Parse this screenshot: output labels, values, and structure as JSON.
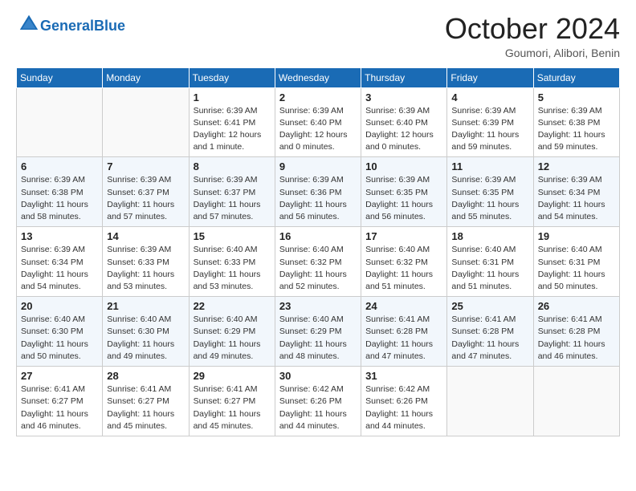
{
  "header": {
    "logo_general": "General",
    "logo_blue": "Blue",
    "month": "October 2024",
    "location": "Goumori, Alibori, Benin"
  },
  "days_of_week": [
    "Sunday",
    "Monday",
    "Tuesday",
    "Wednesday",
    "Thursday",
    "Friday",
    "Saturday"
  ],
  "weeks": [
    [
      {
        "day": "",
        "sunrise": "",
        "sunset": "",
        "daylight": "",
        "empty": true
      },
      {
        "day": "",
        "sunrise": "",
        "sunset": "",
        "daylight": "",
        "empty": true
      },
      {
        "day": "1",
        "sunrise": "Sunrise: 6:39 AM",
        "sunset": "Sunset: 6:41 PM",
        "daylight": "Daylight: 12 hours and 1 minute."
      },
      {
        "day": "2",
        "sunrise": "Sunrise: 6:39 AM",
        "sunset": "Sunset: 6:40 PM",
        "daylight": "Daylight: 12 hours and 0 minutes."
      },
      {
        "day": "3",
        "sunrise": "Sunrise: 6:39 AM",
        "sunset": "Sunset: 6:40 PM",
        "daylight": "Daylight: 12 hours and 0 minutes."
      },
      {
        "day": "4",
        "sunrise": "Sunrise: 6:39 AM",
        "sunset": "Sunset: 6:39 PM",
        "daylight": "Daylight: 11 hours and 59 minutes."
      },
      {
        "day": "5",
        "sunrise": "Sunrise: 6:39 AM",
        "sunset": "Sunset: 6:38 PM",
        "daylight": "Daylight: 11 hours and 59 minutes."
      }
    ],
    [
      {
        "day": "6",
        "sunrise": "Sunrise: 6:39 AM",
        "sunset": "Sunset: 6:38 PM",
        "daylight": "Daylight: 11 hours and 58 minutes."
      },
      {
        "day": "7",
        "sunrise": "Sunrise: 6:39 AM",
        "sunset": "Sunset: 6:37 PM",
        "daylight": "Daylight: 11 hours and 57 minutes."
      },
      {
        "day": "8",
        "sunrise": "Sunrise: 6:39 AM",
        "sunset": "Sunset: 6:37 PM",
        "daylight": "Daylight: 11 hours and 57 minutes."
      },
      {
        "day": "9",
        "sunrise": "Sunrise: 6:39 AM",
        "sunset": "Sunset: 6:36 PM",
        "daylight": "Daylight: 11 hours and 56 minutes."
      },
      {
        "day": "10",
        "sunrise": "Sunrise: 6:39 AM",
        "sunset": "Sunset: 6:35 PM",
        "daylight": "Daylight: 11 hours and 56 minutes."
      },
      {
        "day": "11",
        "sunrise": "Sunrise: 6:39 AM",
        "sunset": "Sunset: 6:35 PM",
        "daylight": "Daylight: 11 hours and 55 minutes."
      },
      {
        "day": "12",
        "sunrise": "Sunrise: 6:39 AM",
        "sunset": "Sunset: 6:34 PM",
        "daylight": "Daylight: 11 hours and 54 minutes."
      }
    ],
    [
      {
        "day": "13",
        "sunrise": "Sunrise: 6:39 AM",
        "sunset": "Sunset: 6:34 PM",
        "daylight": "Daylight: 11 hours and 54 minutes."
      },
      {
        "day": "14",
        "sunrise": "Sunrise: 6:39 AM",
        "sunset": "Sunset: 6:33 PM",
        "daylight": "Daylight: 11 hours and 53 minutes."
      },
      {
        "day": "15",
        "sunrise": "Sunrise: 6:40 AM",
        "sunset": "Sunset: 6:33 PM",
        "daylight": "Daylight: 11 hours and 53 minutes."
      },
      {
        "day": "16",
        "sunrise": "Sunrise: 6:40 AM",
        "sunset": "Sunset: 6:32 PM",
        "daylight": "Daylight: 11 hours and 52 minutes."
      },
      {
        "day": "17",
        "sunrise": "Sunrise: 6:40 AM",
        "sunset": "Sunset: 6:32 PM",
        "daylight": "Daylight: 11 hours and 51 minutes."
      },
      {
        "day": "18",
        "sunrise": "Sunrise: 6:40 AM",
        "sunset": "Sunset: 6:31 PM",
        "daylight": "Daylight: 11 hours and 51 minutes."
      },
      {
        "day": "19",
        "sunrise": "Sunrise: 6:40 AM",
        "sunset": "Sunset: 6:31 PM",
        "daylight": "Daylight: 11 hours and 50 minutes."
      }
    ],
    [
      {
        "day": "20",
        "sunrise": "Sunrise: 6:40 AM",
        "sunset": "Sunset: 6:30 PM",
        "daylight": "Daylight: 11 hours and 50 minutes."
      },
      {
        "day": "21",
        "sunrise": "Sunrise: 6:40 AM",
        "sunset": "Sunset: 6:30 PM",
        "daylight": "Daylight: 11 hours and 49 minutes."
      },
      {
        "day": "22",
        "sunrise": "Sunrise: 6:40 AM",
        "sunset": "Sunset: 6:29 PM",
        "daylight": "Daylight: 11 hours and 49 minutes."
      },
      {
        "day": "23",
        "sunrise": "Sunrise: 6:40 AM",
        "sunset": "Sunset: 6:29 PM",
        "daylight": "Daylight: 11 hours and 48 minutes."
      },
      {
        "day": "24",
        "sunrise": "Sunrise: 6:41 AM",
        "sunset": "Sunset: 6:28 PM",
        "daylight": "Daylight: 11 hours and 47 minutes."
      },
      {
        "day": "25",
        "sunrise": "Sunrise: 6:41 AM",
        "sunset": "Sunset: 6:28 PM",
        "daylight": "Daylight: 11 hours and 47 minutes."
      },
      {
        "day": "26",
        "sunrise": "Sunrise: 6:41 AM",
        "sunset": "Sunset: 6:28 PM",
        "daylight": "Daylight: 11 hours and 46 minutes."
      }
    ],
    [
      {
        "day": "27",
        "sunrise": "Sunrise: 6:41 AM",
        "sunset": "Sunset: 6:27 PM",
        "daylight": "Daylight: 11 hours and 46 minutes."
      },
      {
        "day": "28",
        "sunrise": "Sunrise: 6:41 AM",
        "sunset": "Sunset: 6:27 PM",
        "daylight": "Daylight: 11 hours and 45 minutes."
      },
      {
        "day": "29",
        "sunrise": "Sunrise: 6:41 AM",
        "sunset": "Sunset: 6:27 PM",
        "daylight": "Daylight: 11 hours and 45 minutes."
      },
      {
        "day": "30",
        "sunrise": "Sunrise: 6:42 AM",
        "sunset": "Sunset: 6:26 PM",
        "daylight": "Daylight: 11 hours and 44 minutes."
      },
      {
        "day": "31",
        "sunrise": "Sunrise: 6:42 AM",
        "sunset": "Sunset: 6:26 PM",
        "daylight": "Daylight: 11 hours and 44 minutes."
      },
      {
        "day": "",
        "sunrise": "",
        "sunset": "",
        "daylight": "",
        "empty": true
      },
      {
        "day": "",
        "sunrise": "",
        "sunset": "",
        "daylight": "",
        "empty": true
      }
    ]
  ]
}
